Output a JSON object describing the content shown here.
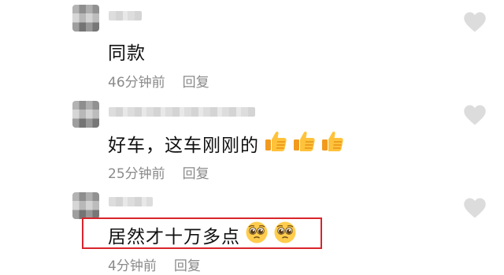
{
  "comments": [
    {
      "text": "同款",
      "time": "46分钟前",
      "reply": "回复",
      "emojis": []
    },
    {
      "text": "好车，这车刚刚的",
      "time": "25分钟前",
      "reply": "回复",
      "emojis": [
        "thumbs-up",
        "thumbs-up",
        "thumbs-up"
      ]
    },
    {
      "text": "居然才十万多点",
      "time": "4分钟前",
      "reply": "回复",
      "emojis": [
        "pleading-face",
        "pleading-face"
      ],
      "highlighted": true
    }
  ],
  "colors": {
    "highlight": "#d9242b",
    "meta": "#8a8a8a",
    "heart": "#dcdcdc"
  }
}
